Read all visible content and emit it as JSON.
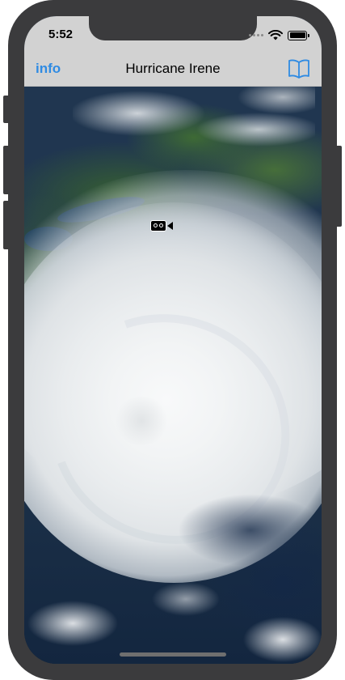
{
  "status_bar": {
    "time": "5:52"
  },
  "nav_bar": {
    "info_label": "info",
    "title": "Hurricane Irene",
    "book_icon": "book-icon"
  },
  "map": {
    "marker_icon": "video-camera-icon"
  },
  "colors": {
    "accent": "#2f8be3",
    "bar_background": "#d2d2d2",
    "frame": "#3b3b3d"
  }
}
